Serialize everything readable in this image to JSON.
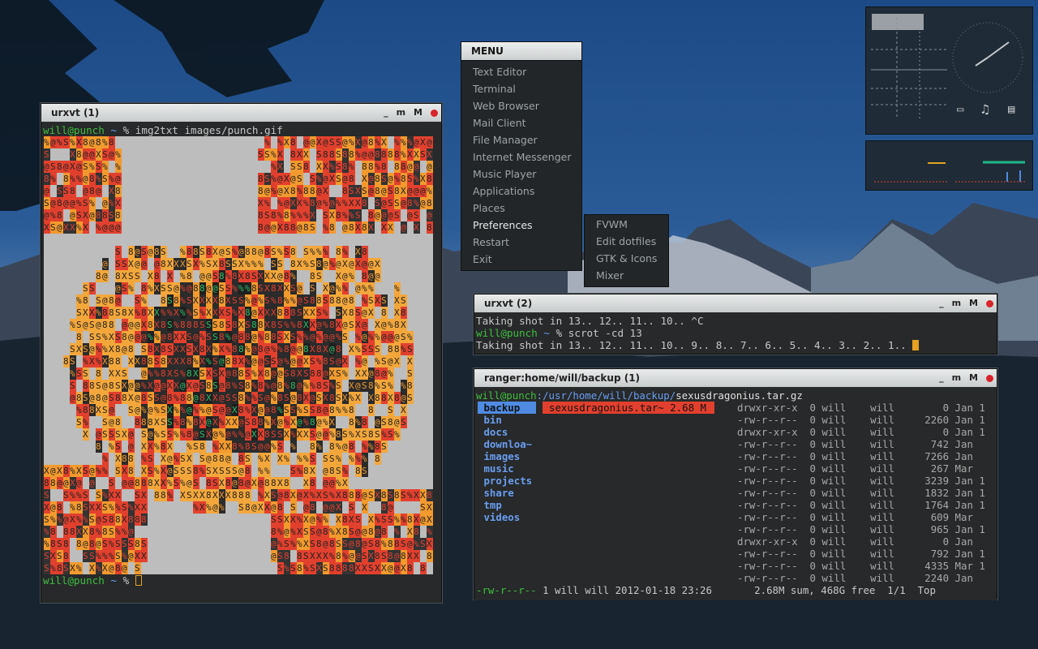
{
  "desktop": {
    "wallpaper": "mountain-landscape",
    "accent": "#e6a122"
  },
  "windows": {
    "urxvt1": {
      "title": "urxvt (1)",
      "buttons": [
        "_",
        "m",
        "M"
      ],
      "prompt_user": "will@punch",
      "prompt_path": "~",
      "prompt_sym": "%",
      "command": "img2txt images/punch.gif",
      "bottom_prompt_user": "will@punch",
      "bottom_prompt_path": "~",
      "bottom_prompt_sym": "%"
    },
    "urxvt2": {
      "title": "urxvt (2)",
      "buttons": [
        "_",
        "m",
        "M"
      ],
      "line1": "Taking shot in 13.. 12.. 11.. 10.. ^C",
      "prompt_user": "will@punch",
      "prompt_path": "~",
      "prompt_sym": "%",
      "command": "scrot -cd 13",
      "line3": "Taking shot in 13.. 12.. 11.. 10.. 9.. 8.. 7.. 6.. 5.. 4.. 3.. 2.. 1.."
    },
    "ranger": {
      "title": "ranger:home/will/backup (1)",
      "buttons": [
        "_",
        "m",
        "M"
      ],
      "path_user": "will@punch",
      "path_dir": ":/usr/home/will/backup/",
      "path_file": "sexusdragonius.tar.gz",
      "dirs": [
        "backup",
        "bin",
        "docs",
        "downloa~",
        "images",
        "music",
        "projects",
        "share",
        "tmp",
        "videos"
      ],
      "selected_file": "sexusdragonius.tar~ 2.68 M",
      "listing": [
        {
          "perm": "drwxr-xr-x",
          "n": "0",
          "u": "will",
          "g": "will",
          "size": "0",
          "date": "Jan 1"
        },
        {
          "perm": "-rw-r--r--",
          "n": "0",
          "u": "will",
          "g": "will",
          "size": "2260",
          "date": "Jan 1"
        },
        {
          "perm": "drwxr-xr-x",
          "n": "0",
          "u": "will",
          "g": "will",
          "size": "0",
          "date": "Jan 1"
        },
        {
          "perm": "-rw-r--r--",
          "n": "0",
          "u": "will",
          "g": "will",
          "size": "742",
          "date": "Jan"
        },
        {
          "perm": "-rw-r--r--",
          "n": "0",
          "u": "will",
          "g": "will",
          "size": "7266",
          "date": "Jan"
        },
        {
          "perm": "-rw-r--r--",
          "n": "0",
          "u": "will",
          "g": "will",
          "size": "267",
          "date": "Mar"
        },
        {
          "perm": "-rw-r--r--",
          "n": "0",
          "u": "will",
          "g": "will",
          "size": "3239",
          "date": "Jan 1"
        },
        {
          "perm": "-rw-r--r--",
          "n": "0",
          "u": "will",
          "g": "will",
          "size": "1832",
          "date": "Jan 1"
        },
        {
          "perm": "-rw-r--r--",
          "n": "0",
          "u": "will",
          "g": "will",
          "size": "1764",
          "date": "Jan 1"
        },
        {
          "perm": "-rw-r--r--",
          "n": "0",
          "u": "will",
          "g": "will",
          "size": "609",
          "date": "Mar"
        },
        {
          "perm": "-rw-r--r--",
          "n": "0",
          "u": "will",
          "g": "will",
          "size": "965",
          "date": "Jan 1"
        },
        {
          "perm": "drwxr-xr-x",
          "n": "0",
          "u": "will",
          "g": "will",
          "size": "0",
          "date": "Jan"
        },
        {
          "perm": "-rw-r--r--",
          "n": "0",
          "u": "will",
          "g": "will",
          "size": "792",
          "date": "Jan 1"
        },
        {
          "perm": "-rw-r--r--",
          "n": "0",
          "u": "will",
          "g": "will",
          "size": "4335",
          "date": "Mar 1"
        },
        {
          "perm": "-rw-r--r--",
          "n": "0",
          "u": "will",
          "g": "will",
          "size": "2240",
          "date": "Jan"
        }
      ],
      "status_perm": "-rw-r--r--",
      "status_info": "1 will will 2012-01-18 23:26",
      "status_right": "2.68M sum, 468G free  1/1  Top"
    }
  },
  "menu": {
    "title": "MENU",
    "items": [
      "Text Editor",
      "Terminal",
      "Web Browser",
      "Mail Client",
      "File Manager",
      "Internet Messenger",
      "Music Player",
      "Applications",
      "Places",
      "Preferences",
      "Restart",
      "Exit"
    ],
    "active": "Preferences",
    "submenu": [
      "FVWM",
      "Edit dotfiles",
      "GTK & Icons",
      "Mixer"
    ]
  },
  "widgets": {
    "icons": [
      "laptop-icon",
      "music-note-icon",
      "card-icon"
    ]
  }
}
